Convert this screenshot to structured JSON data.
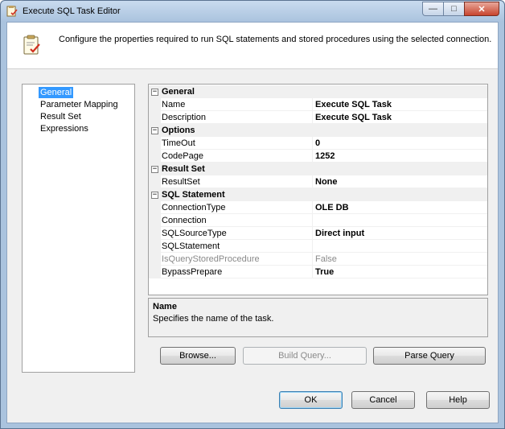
{
  "window": {
    "title": "Execute SQL Task Editor",
    "caption_minimize": "—",
    "caption_maximize": "□",
    "caption_close": "✕"
  },
  "header": {
    "description": "Configure the properties required to run SQL statements and stored procedures using the selected connection."
  },
  "nav": {
    "items": [
      {
        "label": "General",
        "selected": true
      },
      {
        "label": "Parameter Mapping"
      },
      {
        "label": "Result Set"
      },
      {
        "label": "Expressions"
      }
    ]
  },
  "grid": {
    "expander_symbol": "−",
    "categories": {
      "general": "General",
      "options": "Options",
      "result_set": "Result Set",
      "sql_statement": "SQL Statement"
    },
    "props": {
      "name": {
        "label": "Name",
        "value": "Execute SQL Task"
      },
      "description": {
        "label": "Description",
        "value": "Execute SQL Task"
      },
      "timeout": {
        "label": "TimeOut",
        "value": "0"
      },
      "codepage": {
        "label": "CodePage",
        "value": "1252"
      },
      "resultset": {
        "label": "ResultSet",
        "value": "None"
      },
      "connectiontype": {
        "label": "ConnectionType",
        "value": "OLE DB"
      },
      "connection": {
        "label": "Connection",
        "value": ""
      },
      "sqlsourcetype": {
        "label": "SQLSourceType",
        "value": "Direct input"
      },
      "sqlstatement": {
        "label": "SQLStatement",
        "value": ""
      },
      "isquerystoredprocedure": {
        "label": "IsQueryStoredProcedure",
        "value": "False"
      },
      "bypassprepare": {
        "label": "BypassPrepare",
        "value": "True"
      }
    }
  },
  "description_panel": {
    "title": "Name",
    "text": "Specifies the name of the task."
  },
  "buttons": {
    "browse": "Browse...",
    "build_query": "Build Query...",
    "parse_query": "Parse Query",
    "ok": "OK",
    "cancel": "Cancel",
    "help": "Help"
  }
}
